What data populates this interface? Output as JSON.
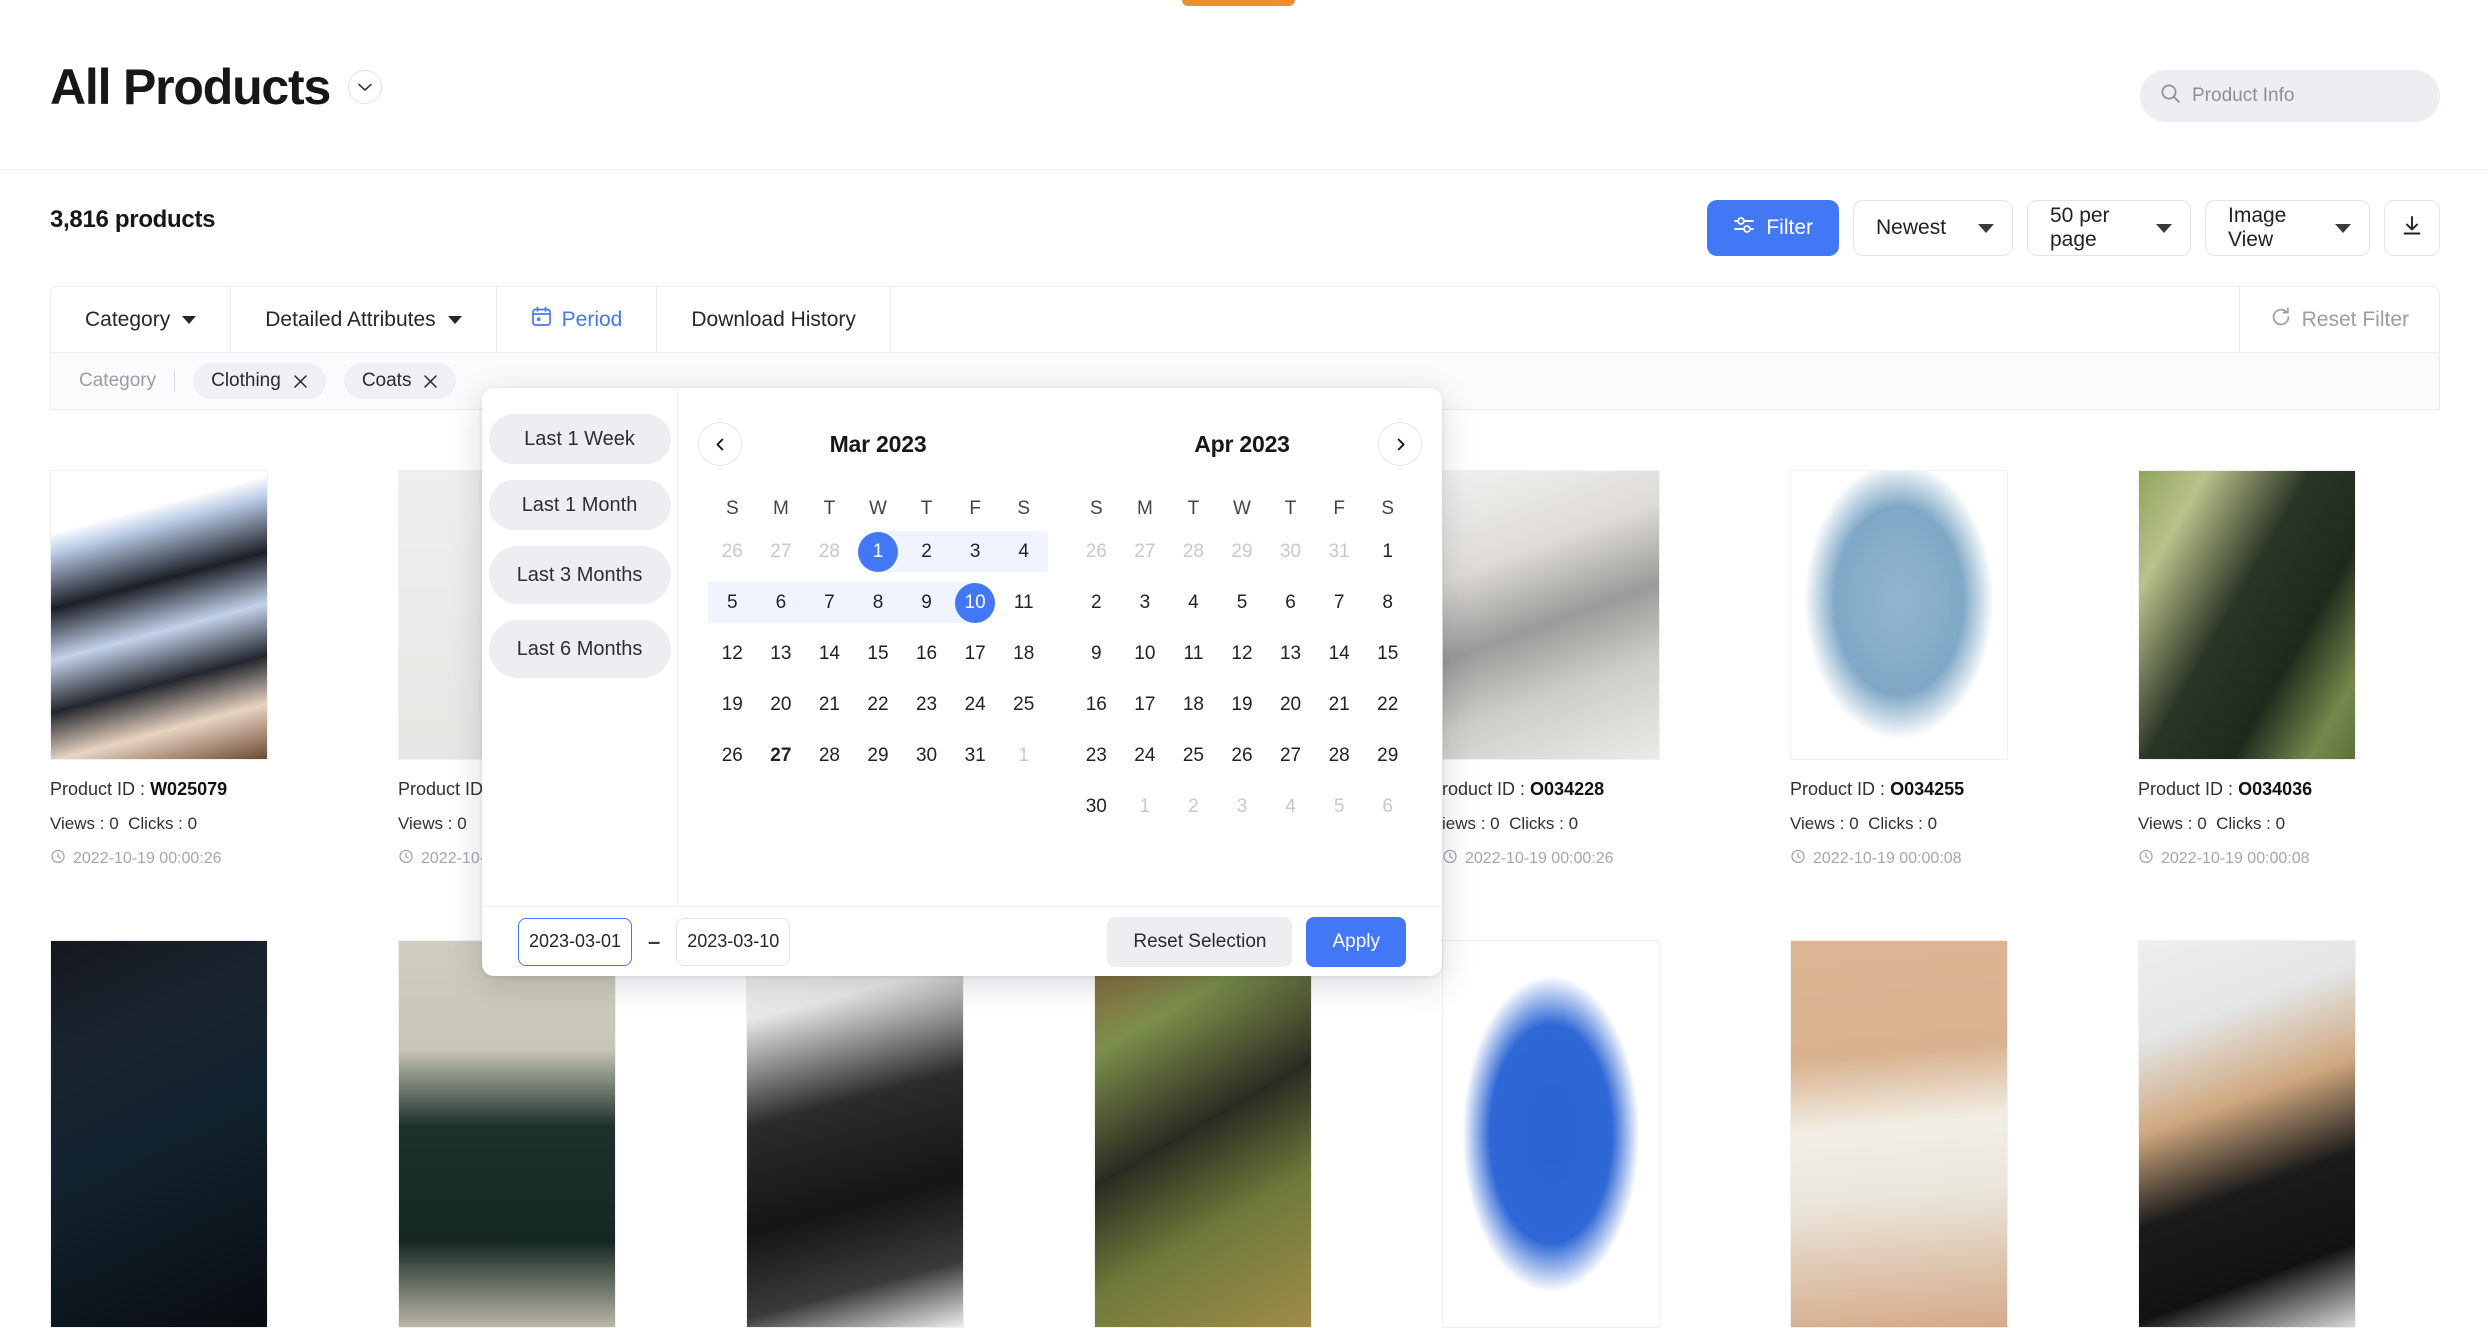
{
  "header": {
    "title": "All Products",
    "title_caret_icon": "chevron-down-icon",
    "search": {
      "icon": "search-icon",
      "placeholder": "Product Info",
      "value": ""
    }
  },
  "toolbar": {
    "product_count": "3,816 products",
    "filter_label": "Filter",
    "filter_icon": "sliders-icon",
    "sort_value": "Newest",
    "per_page_value": "50 per page",
    "view_value": "Image View",
    "download_icon": "download-icon"
  },
  "filter_tabs": {
    "items": [
      {
        "label": "Category",
        "has_caret": true,
        "active": false,
        "icon": ""
      },
      {
        "label": "Detailed Attributes",
        "has_caret": true,
        "active": false,
        "icon": ""
      },
      {
        "label": "Period",
        "has_caret": false,
        "active": true,
        "icon": "calendar-icon"
      },
      {
        "label": "Download History",
        "has_caret": false,
        "active": false,
        "icon": ""
      }
    ],
    "reset_label": "Reset Filter",
    "reset_icon": "refresh-icon"
  },
  "applied_filters": {
    "label": "Category",
    "chips": [
      {
        "label": "Clothing",
        "remove_icon": "close-icon"
      },
      {
        "label": "Coats",
        "remove_icon": "close-icon"
      }
    ]
  },
  "date_picker": {
    "presets": [
      {
        "label": "Last 1 Week",
        "two_line": false
      },
      {
        "label": "Last 1 Month",
        "two_line": false
      },
      {
        "label": "Last 3 Months",
        "two_line": true
      },
      {
        "label": "Last 6 Months",
        "two_line": true
      }
    ],
    "prev_icon": "chevron-left-icon",
    "next_icon": "chevron-right-icon",
    "dow": [
      "S",
      "M",
      "T",
      "W",
      "T",
      "F",
      "S"
    ],
    "calendars": [
      {
        "title": "Mar 2023",
        "weeks": [
          [
            {
              "d": "26",
              "state": "muted"
            },
            {
              "d": "27",
              "state": "muted"
            },
            {
              "d": "28",
              "state": "muted"
            },
            {
              "d": "1",
              "state": "sel-start"
            },
            {
              "d": "2",
              "state": "range"
            },
            {
              "d": "3",
              "state": "range"
            },
            {
              "d": "4",
              "state": "range"
            }
          ],
          [
            {
              "d": "5",
              "state": "range"
            },
            {
              "d": "6",
              "state": "range"
            },
            {
              "d": "7",
              "state": "range"
            },
            {
              "d": "8",
              "state": "range"
            },
            {
              "d": "9",
              "state": "range"
            },
            {
              "d": "10",
              "state": "sel-end"
            },
            {
              "d": "11",
              "state": "normal"
            }
          ],
          [
            {
              "d": "12",
              "state": "normal"
            },
            {
              "d": "13",
              "state": "normal"
            },
            {
              "d": "14",
              "state": "normal"
            },
            {
              "d": "15",
              "state": "normal"
            },
            {
              "d": "16",
              "state": "normal"
            },
            {
              "d": "17",
              "state": "normal"
            },
            {
              "d": "18",
              "state": "normal"
            }
          ],
          [
            {
              "d": "19",
              "state": "normal"
            },
            {
              "d": "20",
              "state": "normal"
            },
            {
              "d": "21",
              "state": "normal"
            },
            {
              "d": "22",
              "state": "normal"
            },
            {
              "d": "23",
              "state": "normal"
            },
            {
              "d": "24",
              "state": "normal"
            },
            {
              "d": "25",
              "state": "normal"
            }
          ],
          [
            {
              "d": "26",
              "state": "normal"
            },
            {
              "d": "27",
              "state": "today"
            },
            {
              "d": "28",
              "state": "normal"
            },
            {
              "d": "29",
              "state": "normal"
            },
            {
              "d": "30",
              "state": "normal"
            },
            {
              "d": "31",
              "state": "normal"
            },
            {
              "d": "1",
              "state": "muted"
            }
          ]
        ]
      },
      {
        "title": "Apr 2023",
        "weeks": [
          [
            {
              "d": "26",
              "state": "muted"
            },
            {
              "d": "27",
              "state": "muted"
            },
            {
              "d": "28",
              "state": "muted"
            },
            {
              "d": "29",
              "state": "muted"
            },
            {
              "d": "30",
              "state": "muted"
            },
            {
              "d": "31",
              "state": "muted"
            },
            {
              "d": "1",
              "state": "normal"
            }
          ],
          [
            {
              "d": "2",
              "state": "normal"
            },
            {
              "d": "3",
              "state": "normal"
            },
            {
              "d": "4",
              "state": "normal"
            },
            {
              "d": "5",
              "state": "normal"
            },
            {
              "d": "6",
              "state": "normal"
            },
            {
              "d": "7",
              "state": "normal"
            },
            {
              "d": "8",
              "state": "normal"
            }
          ],
          [
            {
              "d": "9",
              "state": "normal"
            },
            {
              "d": "10",
              "state": "normal"
            },
            {
              "d": "11",
              "state": "normal"
            },
            {
              "d": "12",
              "state": "normal"
            },
            {
              "d": "13",
              "state": "normal"
            },
            {
              "d": "14",
              "state": "normal"
            },
            {
              "d": "15",
              "state": "normal"
            }
          ],
          [
            {
              "d": "16",
              "state": "normal"
            },
            {
              "d": "17",
              "state": "normal"
            },
            {
              "d": "18",
              "state": "normal"
            },
            {
              "d": "19",
              "state": "normal"
            },
            {
              "d": "20",
              "state": "normal"
            },
            {
              "d": "21",
              "state": "normal"
            },
            {
              "d": "22",
              "state": "normal"
            }
          ],
          [
            {
              "d": "23",
              "state": "normal"
            },
            {
              "d": "24",
              "state": "normal"
            },
            {
              "d": "25",
              "state": "normal"
            },
            {
              "d": "26",
              "state": "normal"
            },
            {
              "d": "27",
              "state": "normal"
            },
            {
              "d": "28",
              "state": "normal"
            },
            {
              "d": "29",
              "state": "normal"
            }
          ],
          [
            {
              "d": "30",
              "state": "normal"
            },
            {
              "d": "1",
              "state": "muted"
            },
            {
              "d": "2",
              "state": "muted"
            },
            {
              "d": "3",
              "state": "muted"
            },
            {
              "d": "4",
              "state": "muted"
            },
            {
              "d": "5",
              "state": "muted"
            },
            {
              "d": "6",
              "state": "muted"
            }
          ]
        ]
      }
    ],
    "start_date": "2023-03-01",
    "end_date": "2023-03-10",
    "separator": "–",
    "reset_selection_label": "Reset Selection",
    "apply_label": "Apply"
  },
  "products_row1": [
    {
      "id_label": "Product ID :",
      "id": "W025079",
      "views_label": "Views : 0",
      "clicks_label": "Clicks : 0",
      "time": "2022-10-19 00:00:26",
      "time_icon": "clock-icon"
    },
    {
      "id_label": "Product ID :",
      "id": "",
      "views_label": "Views : 0",
      "clicks_label": "",
      "time": "2022-10-…",
      "time_icon": "clock-icon"
    },
    {
      "id_label": "",
      "id": "",
      "views_label": "",
      "clicks_label": "",
      "time": "",
      "time_icon": "clock-icon"
    },
    {
      "id_label": "",
      "id": "",
      "views_label": "",
      "clicks_label": "",
      "time": "",
      "time_icon": "clock-icon"
    },
    {
      "id_label": "roduct ID :",
      "id": "O034228",
      "views_label": "iews : 0",
      "clicks_label": "Clicks : 0",
      "time": "2022-10-19 00:00:26",
      "time_icon": "clock-icon"
    },
    {
      "id_label": "Product ID :",
      "id": "O034255",
      "views_label": "Views : 0",
      "clicks_label": "Clicks : 0",
      "time": "2022-10-19 00:00:08",
      "time_icon": "clock-icon"
    },
    {
      "id_label": "Product ID :",
      "id": "O034036",
      "views_label": "Views : 0",
      "clicks_label": "Clicks : 0",
      "time": "2022-10-19 00:00:08",
      "time_icon": "clock-icon"
    }
  ],
  "colors": {
    "accent": "#4278f5",
    "chip_bg": "#eceef1",
    "range_bg": "#f0f4fe",
    "muted_text": "#c6c8cd",
    "top_sliver": "#ef8f2c"
  }
}
